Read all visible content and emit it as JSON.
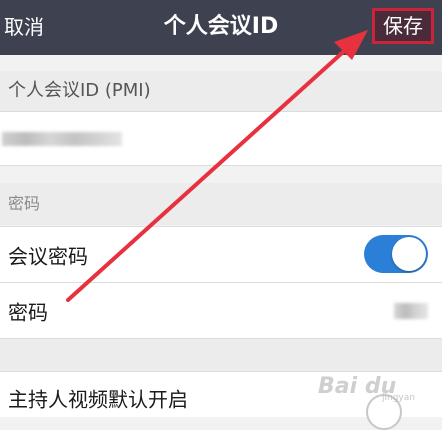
{
  "navbar": {
    "cancel_label": "取消",
    "title": "个人会议ID",
    "save_label": "保存"
  },
  "pmi_section": {
    "header": "个人会议ID (PMI)"
  },
  "password_section": {
    "header": "密码",
    "meeting_password_label": "会议密码",
    "meeting_password_enabled": true,
    "password_label": "密码"
  },
  "host_video": {
    "label": "主持人视频默认开启",
    "enabled": false
  },
  "watermark": {
    "text": "Bai du",
    "subtext": "jingyan"
  },
  "colors": {
    "navbar_bg": "#3e4250",
    "toggle_on": "#2c7fd6",
    "highlight": "#e8313f"
  }
}
